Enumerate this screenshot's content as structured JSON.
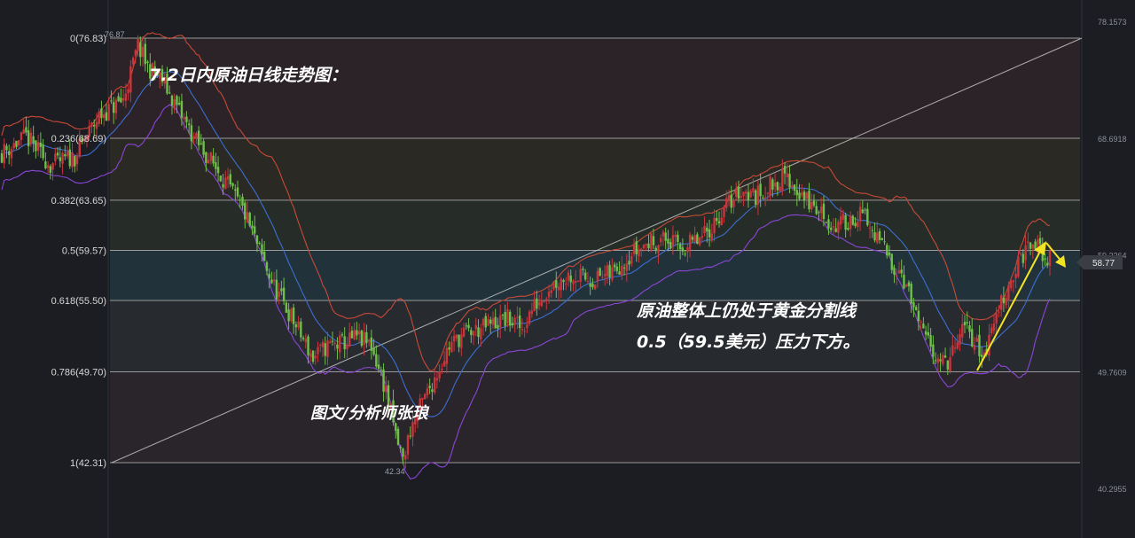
{
  "chart_data": {
    "type": "candlestick",
    "title": "7.2日内原油日线走势图：",
    "annotation": "原油整体上仍处于黄金分割线",
    "annotation_line2": "0.5（59.5美元）压力下方。",
    "author": "图文/分析师张琅",
    "ylim": [
      40.2955,
      78.1573
    ],
    "y_ticks": [
      "78.1573",
      "68.6918",
      "59.2264",
      "49.7609",
      "40.2955"
    ],
    "fib_levels": [
      {
        "ratio": "0",
        "price": 76.83,
        "label": "0(76.83)"
      },
      {
        "ratio": "0.236",
        "price": 68.69,
        "label": "0.236(68.69)"
      },
      {
        "ratio": "0.382",
        "price": 63.65,
        "label": "0.382(63.65)"
      },
      {
        "ratio": "0.5",
        "price": 59.57,
        "label": "0.5(59.57)"
      },
      {
        "ratio": "0.618",
        "price": 55.5,
        "label": "0.618(55.50)"
      },
      {
        "ratio": "0.786",
        "price": 49.7,
        "label": "0.786(49.70)"
      },
      {
        "ratio": "1",
        "price": 42.31,
        "label": "1(42.31)"
      }
    ],
    "high_label": "76.87",
    "low_label": "42.34",
    "last_price": "58.77",
    "close_path": [
      [
        0,
        67.5
      ],
      [
        10,
        68.8
      ],
      [
        20,
        66.5
      ],
      [
        30,
        67.2
      ],
      [
        40,
        70.5
      ],
      [
        50,
        71.8
      ],
      [
        56,
        76.2
      ],
      [
        60,
        74.5
      ],
      [
        66,
        73.4
      ],
      [
        72,
        71.2
      ],
      [
        80,
        68.4
      ],
      [
        90,
        65.8
      ],
      [
        100,
        62.5
      ],
      [
        108,
        58.5
      ],
      [
        112,
        56.6
      ],
      [
        120,
        53.8
      ],
      [
        128,
        50.8
      ],
      [
        134,
        51.8
      ],
      [
        140,
        52.0
      ],
      [
        146,
        52.5
      ],
      [
        152,
        51.8
      ],
      [
        158,
        48.2
      ],
      [
        162,
        44.5
      ],
      [
        165,
        42.5
      ],
      [
        168,
        45.0
      ],
      [
        172,
        46.8
      ],
      [
        178,
        49.2
      ],
      [
        184,
        51.8
      ],
      [
        190,
        52.8
      ],
      [
        196,
        53.1
      ],
      [
        202,
        53.6
      ],
      [
        208,
        54.0
      ],
      [
        214,
        53.2
      ],
      [
        218,
        54.8
      ],
      [
        226,
        56.8
      ],
      [
        234,
        57.6
      ],
      [
        242,
        57.2
      ],
      [
        250,
        57.6
      ],
      [
        258,
        59.2
      ],
      [
        266,
        60.2
      ],
      [
        272,
        60.5
      ],
      [
        280,
        59.8
      ],
      [
        288,
        60.5
      ],
      [
        298,
        63.2
      ],
      [
        304,
        64.5
      ],
      [
        310,
        64.0
      ],
      [
        316,
        64.8
      ],
      [
        322,
        65.6
      ],
      [
        328,
        64.3
      ],
      [
        334,
        63.0
      ],
      [
        338,
        62.5
      ],
      [
        342,
        61.4
      ],
      [
        348,
        62.0
      ],
      [
        354,
        62.5
      ],
      [
        358,
        61.0
      ],
      [
        362,
        60.0
      ],
      [
        366,
        58.6
      ],
      [
        370,
        57.8
      ],
      [
        374,
        55.5
      ],
      [
        378,
        53.0
      ],
      [
        382,
        51.8
      ],
      [
        388,
        50.2
      ],
      [
        392,
        51.5
      ],
      [
        396,
        53.5
      ],
      [
        400,
        52.2
      ],
      [
        404,
        51.0
      ],
      [
        410,
        55.0
      ],
      [
        416,
        57.6
      ],
      [
        420,
        59.2
      ],
      [
        423,
        60.0
      ],
      [
        426,
        59.8
      ],
      [
        430,
        58.8
      ]
    ],
    "moving_average": "blue line",
    "bollinger_upper": "red line",
    "bollinger_lower": "purple line"
  },
  "colors": {
    "background": "#1b1d22",
    "up_candle": "#c8363c",
    "down_candle": "#6fbf4a",
    "upper_band": "#c84a36",
    "middle_band": "#3b6fd1",
    "lower_band": "#8a46d6",
    "arrow": "#f2e324",
    "fib_line": "#bfbfbf"
  }
}
